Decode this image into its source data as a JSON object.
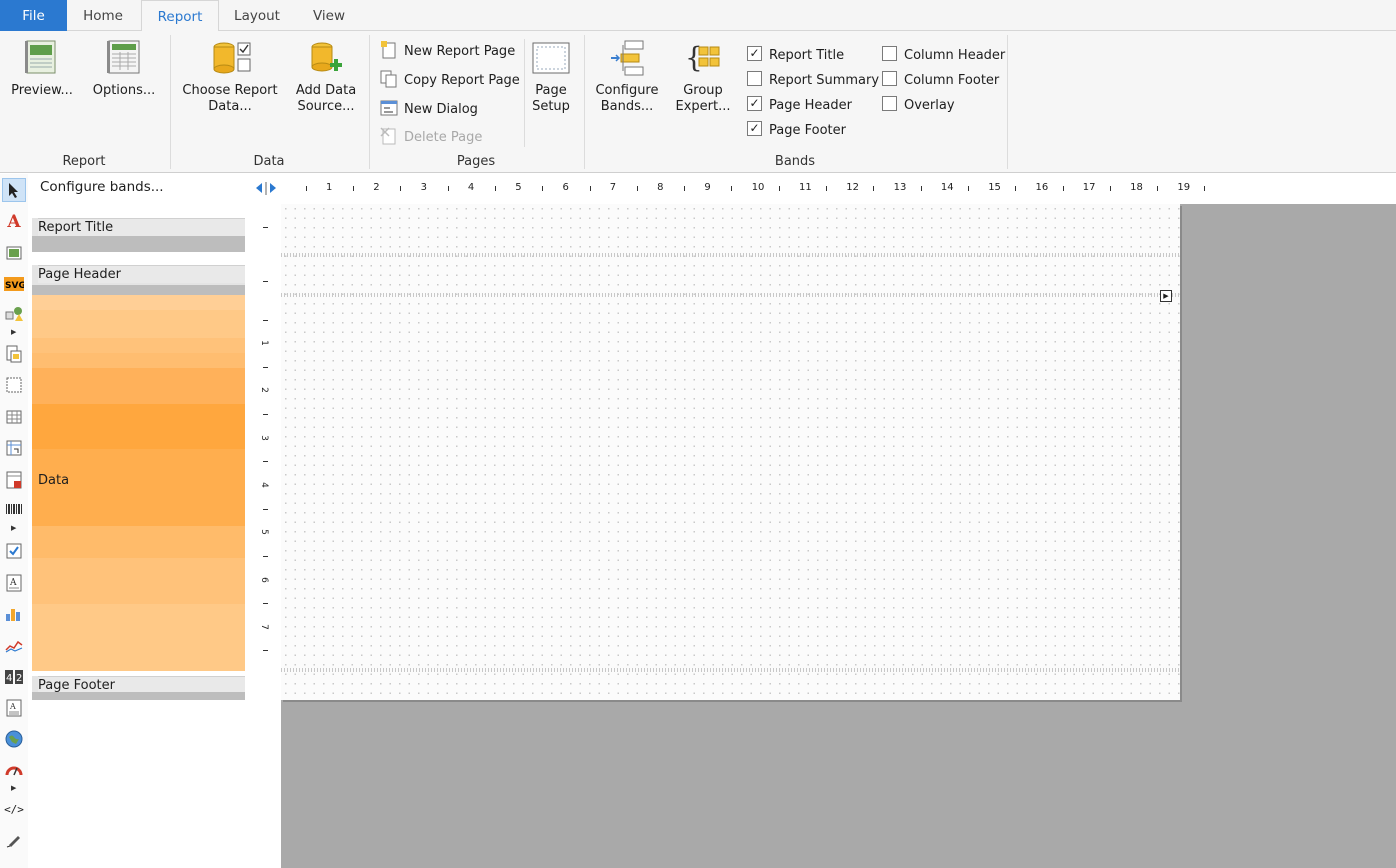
{
  "tabs": [
    {
      "label": "File"
    },
    {
      "label": "Home"
    },
    {
      "label": "Report"
    },
    {
      "label": "Layout"
    },
    {
      "label": "View"
    }
  ],
  "ribbon": {
    "groups": {
      "report": "Report",
      "data": "Data",
      "pages": "Pages",
      "bands": "Bands"
    },
    "preview": {
      "line1": "Preview..."
    },
    "options": {
      "line1": "Options..."
    },
    "choose_data": {
      "line1": "Choose Report",
      "line2": "Data..."
    },
    "add_source": {
      "line1": "Add Data",
      "line2": "Source..."
    },
    "new_page": "New Report Page",
    "copy_page": "Copy Report Page",
    "new_dialog": "New Dialog",
    "delete_page": "Delete Page",
    "page_setup": {
      "line1": "Page",
      "line2": "Setup"
    },
    "configure_bands": {
      "line1": "Configure",
      "line2": "Bands..."
    },
    "group_expert": {
      "line1": "Group",
      "line2": "Expert..."
    },
    "checks": {
      "report_title": {
        "label": "Report Title",
        "checked": true
      },
      "report_summary": {
        "label": "Report Summary",
        "checked": false
      },
      "page_header": {
        "label": "Page Header",
        "checked": true
      },
      "page_footer": {
        "label": "Page Footer",
        "checked": true
      },
      "column_header": {
        "label": "Column Header",
        "checked": false
      },
      "column_footer": {
        "label": "Column Footer",
        "checked": false
      },
      "overlay": {
        "label": "Overlay",
        "checked": false
      }
    }
  },
  "designer": {
    "configure_bands_link": "Configure bands...",
    "bands": {
      "report_title": "Report Title",
      "page_header": "Page Header",
      "data": "Data",
      "page_footer": "Page Footer"
    },
    "ruler_h": [
      "1",
      "2",
      "3",
      "4",
      "5",
      "6",
      "7",
      "8",
      "9",
      "10",
      "11",
      "12",
      "13",
      "14",
      "15",
      "16",
      "17",
      "18",
      "19"
    ],
    "ruler_v": [
      "1",
      "2",
      "3",
      "4",
      "5",
      "6",
      "7"
    ]
  },
  "colors": {
    "accent": "#2b79d0",
    "data_band": "#ffb054",
    "canvas_gray": "#a9a9a9"
  }
}
